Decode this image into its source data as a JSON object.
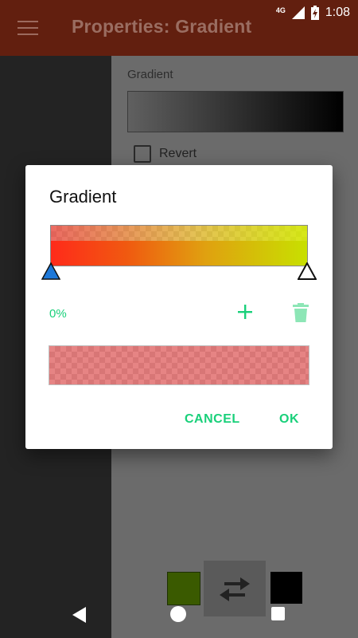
{
  "status_bar": {
    "network": "4G",
    "time": "1:08",
    "signal_icon": "cell-signal-icon",
    "battery_icon": "battery-charging-icon"
  },
  "app_bar": {
    "menu_icon": "hamburger-menu-icon",
    "title": "Properties: Gradient"
  },
  "properties": {
    "gradient_label": "Gradient",
    "revert_label": "Revert",
    "revert_checked": false
  },
  "dialog": {
    "title": "Gradient",
    "selected_stop_position": "0%",
    "add_icon": "plus-icon",
    "delete_icon": "trash-icon",
    "cancel_label": "CANCEL",
    "ok_label": "OK",
    "accent_color": "#19d07a"
  },
  "bottom_bar": {
    "primary_color": "#3a5a00",
    "secondary_color": "#000000",
    "swap_icon": "swap-arrows-icon"
  },
  "nav_bar": {
    "back_icon": "back-triangle-icon",
    "home_icon": "home-circle-icon",
    "recent_icon": "recent-square-icon"
  }
}
